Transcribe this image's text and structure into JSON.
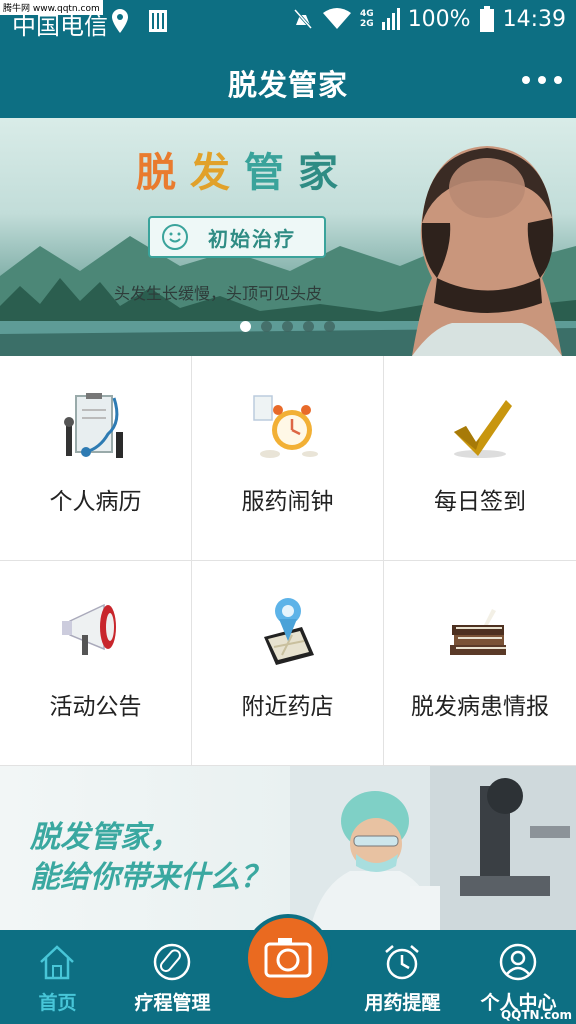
{
  "watermark_top": "腾牛网 www.qqtn.com",
  "statusbar": {
    "carrier": "中国电信",
    "net_4g": "4G",
    "net_2g": "2G",
    "battery": "100%",
    "time": "14:39"
  },
  "appbar": {
    "title": "脱发管家",
    "more_icon": "more-dots-icon"
  },
  "banner": {
    "brand": [
      "脱",
      "发",
      "管",
      "家"
    ],
    "stage": "初始治疗",
    "description": "头发生长缓慢，头顶可见头皮",
    "slide_count": 5,
    "active_slide": 0
  },
  "grid": {
    "items": [
      {
        "label": "个人病历",
        "icon": "medical-record-icon"
      },
      {
        "label": "服药闹钟",
        "icon": "alarm-clock-icon"
      },
      {
        "label": "每日签到",
        "icon": "checkmark-icon"
      },
      {
        "label": "活动公告",
        "icon": "megaphone-icon"
      },
      {
        "label": "附近药店",
        "icon": "map-pin-phone-icon"
      },
      {
        "label": "脱发病患情报",
        "icon": "books-icon"
      }
    ]
  },
  "promo": {
    "line1": "脱发管家，",
    "line2": "能给你带来什么？"
  },
  "bottomnav": {
    "items": [
      {
        "label": "首页",
        "icon": "home-icon",
        "active": true
      },
      {
        "label": "疗程管理",
        "icon": "pill-icon",
        "active": false
      },
      {
        "label": "",
        "icon": "camera-icon",
        "active": false
      },
      {
        "label": "用药提醒",
        "icon": "alarm-icon",
        "active": false
      },
      {
        "label": "个人中心",
        "icon": "user-icon",
        "active": false
      }
    ],
    "watermark": "QQTN.com"
  },
  "colors": {
    "primary": "#0d6f83",
    "accent": "#ea6a20",
    "active_tab": "#48c6d8",
    "teal_text": "#3aa8a0"
  }
}
